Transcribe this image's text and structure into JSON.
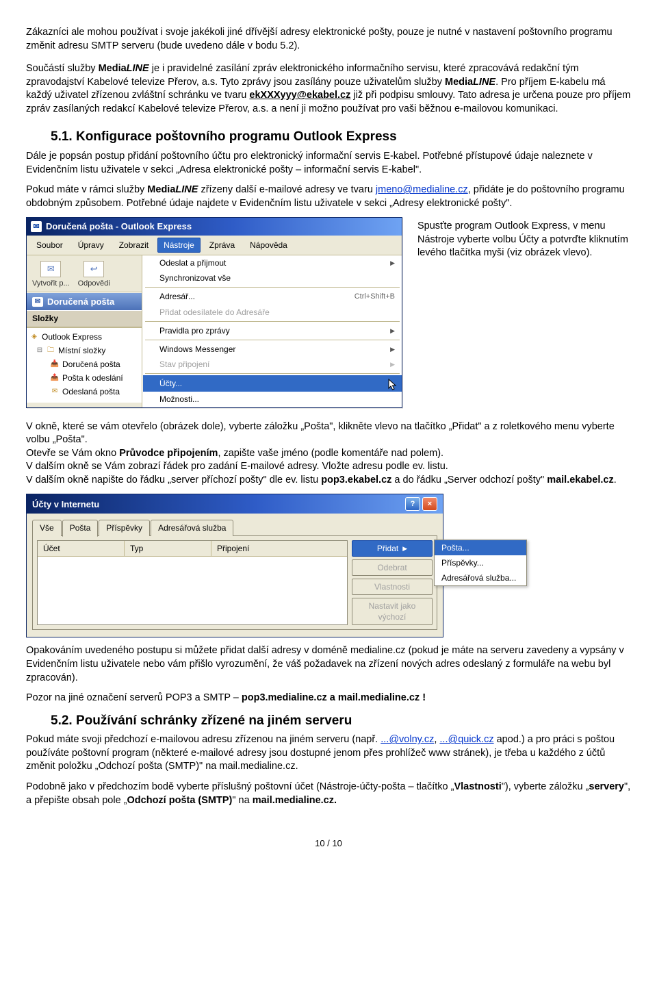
{
  "intro": {
    "p1": "Zákazníci ale mohou používat i svoje jakékoli jiné dřívější adresy elektronické pošty, pouze je nutné v nastavení poštovního programu změnit adresu SMTP serveru (bude uvedeno dále v bodu 5.2).",
    "p2a": "Součástí služby ",
    "p2_brand": "MediaLINE",
    "p2b": " je i pravidelné zasílání zpráv elektronického informačního servisu, které zpracovává redakční tým zpravodajství Kabelové televize Přerov, a.s. Tyto zprávy jsou zasílány pouze uživatelům služby ",
    "p2c": ". Pro příjem E-kabelu má každý uživatel zřízenou zvláštní schránku ve tvaru ",
    "p2_email": "ekXXXyyy@ekabel.cz",
    "p2d": " již při podpisu smlouvy. Tato adresa je určena pouze pro příjem zpráv zasílaných redakcí Kabelové televize Přerov, a.s. a není ji možno používat pro vaši běžnou e-mailovou komunikaci."
  },
  "sec51": {
    "heading": "5.1. Konfigurace poštovního programu Outlook Express",
    "p1": "Dále je popsán postup přidání poštovního účtu pro elektronický informační servis E-kabel. Potřebné přístupové údaje naleznete v Evidenčním listu uživatele v sekci „Adresa elektronické pošty – informační servis E-kabel\".",
    "p2a": "Pokud máte v rámci služby ",
    "p2_brand": "MediaLINE",
    "p2b": " zřízeny další e-mailové adresy ve tvaru ",
    "p2_link": "jmeno@medialine.cz",
    "p2c": ", přidáte je do poštovního programu obdobným způsobem. Potřebné údaje najdete v Evidenčním listu uživatele v sekci „Adresy elektronické pošty\".",
    "side": "Spusťte program Outlook Express, v menu Nástroje vyberte volbu Účty a potvrďte kliknutím levého tlačítka myši (viz obrázek vlevo)."
  },
  "oe": {
    "title": "Doručená pošta - Outlook Express",
    "menubar": [
      "Soubor",
      "Úpravy",
      "Zobrazit",
      "Nástroje",
      "Zpráva",
      "Nápověda"
    ],
    "toolbar": {
      "create": "Vytvořit p...",
      "reply": "Odpovědi"
    },
    "hdr_inbox": "Doručená pošta",
    "hdr_folders": "Složky",
    "tree": {
      "root": "Outlook Express",
      "local": "Místní složky",
      "inbox": "Doručená pošta",
      "outbox": "Pošta k odeslání",
      "sent": "Odeslaná pošta"
    },
    "menu": {
      "sendrecv": "Odeslat a přijmout",
      "sync": "Synchronizovat vše",
      "addrbook": "Adresář...",
      "addrbook_kb": "Ctrl+Shift+B",
      "addsender": "Přidat odesílatele do Adresáře",
      "rules": "Pravidla pro zprávy",
      "wm": "Windows Messenger",
      "connstate": "Stav připojení",
      "accounts": "Účty...",
      "options": "Možnosti..."
    }
  },
  "mid": {
    "p1": "V okně, které se vám otevřelo (obrázek dole), vyberte záložku „Pošta\", klikněte vlevo na tlačítko „Přidat\" a z roletkového menu vyberte volbu „Pošta\".",
    "p2a": "Otevře se Vám okno ",
    "p2b": "Průvodce připojením",
    "p2c": ", zapište vaše jméno (podle komentáře nad polem).",
    "p3": "V dalším okně se Vám zobrazí řádek pro zadání E-mailové adresy. Vložte adresu podle ev. listu.",
    "p4a": "V dalším okně napište do řádku „server příchozí pošty\" dle ev. listu ",
    "p4b": "pop3.ekabel.cz",
    "p4c": " a do řádku „Server odchozí pošty\" ",
    "p4d": "mail.ekabel.cz",
    "p4e": "."
  },
  "acct": {
    "title": "Účty v Internetu",
    "tabs": [
      "Vše",
      "Pošta",
      "Příspěvky",
      "Adresářová služba"
    ],
    "cols": [
      "Účet",
      "Typ",
      "Připojení"
    ],
    "btns": {
      "add": "Přidat",
      "remove": "Odebrat",
      "props": "Vlastnosti",
      "default": "Nastavit jako výchozí"
    },
    "popup": [
      "Pošta...",
      "Příspěvky...",
      "Adresářová služba..."
    ]
  },
  "after": {
    "p1": "Opakováním uvedeného postupu si můžete přidat další adresy v doméně medialine.cz (pokud je máte na serveru zavedeny a vypsány v Evidenčním listu uživatele nebo vám přišlo vyrozumění, že váš požadavek na zřízení nových adres odeslaný z formuláře na webu byl zpracován).",
    "p2a": "Pozor na jiné označení serverů POP3 a SMTP – ",
    "p2b": "pop3.medialine.cz a mail.medialine.cz !"
  },
  "sec52": {
    "heading": "5.2. Používání schránky zřízené na jiném serveru",
    "p1a": "Pokud máte svoji předchozí e-mailovou adresu zřízenou na jiném serveru (např. ",
    "p1_l1": "...@volny.cz",
    "p1b": ", ",
    "p1_l2": "...@quick.cz",
    "p1c": " apod.) a pro práci s poštou používáte poštovní program (některé e-mailové adresy jsou dostupné jenom přes prohlížeč www stránek), je třeba u každého z účtů změnit položku „Odchozí pošta (SMTP)\" na mail.medialine.cz.",
    "p2a": "Podobně jako v předchozím bodě vyberte příslušný poštovní účet (Nástroje-účty-pošta – tlačítko „",
    "p2b": "Vlastnosti",
    "p2c": "\"), vyberte záložku „",
    "p2d": "servery",
    "p2e": "\", a přepište obsah pole „",
    "p2f": "Odchozí pošta (SMTP)",
    "p2g": "\" na ",
    "p2h": "mail.medialine.cz."
  },
  "footer": "10 / 10"
}
